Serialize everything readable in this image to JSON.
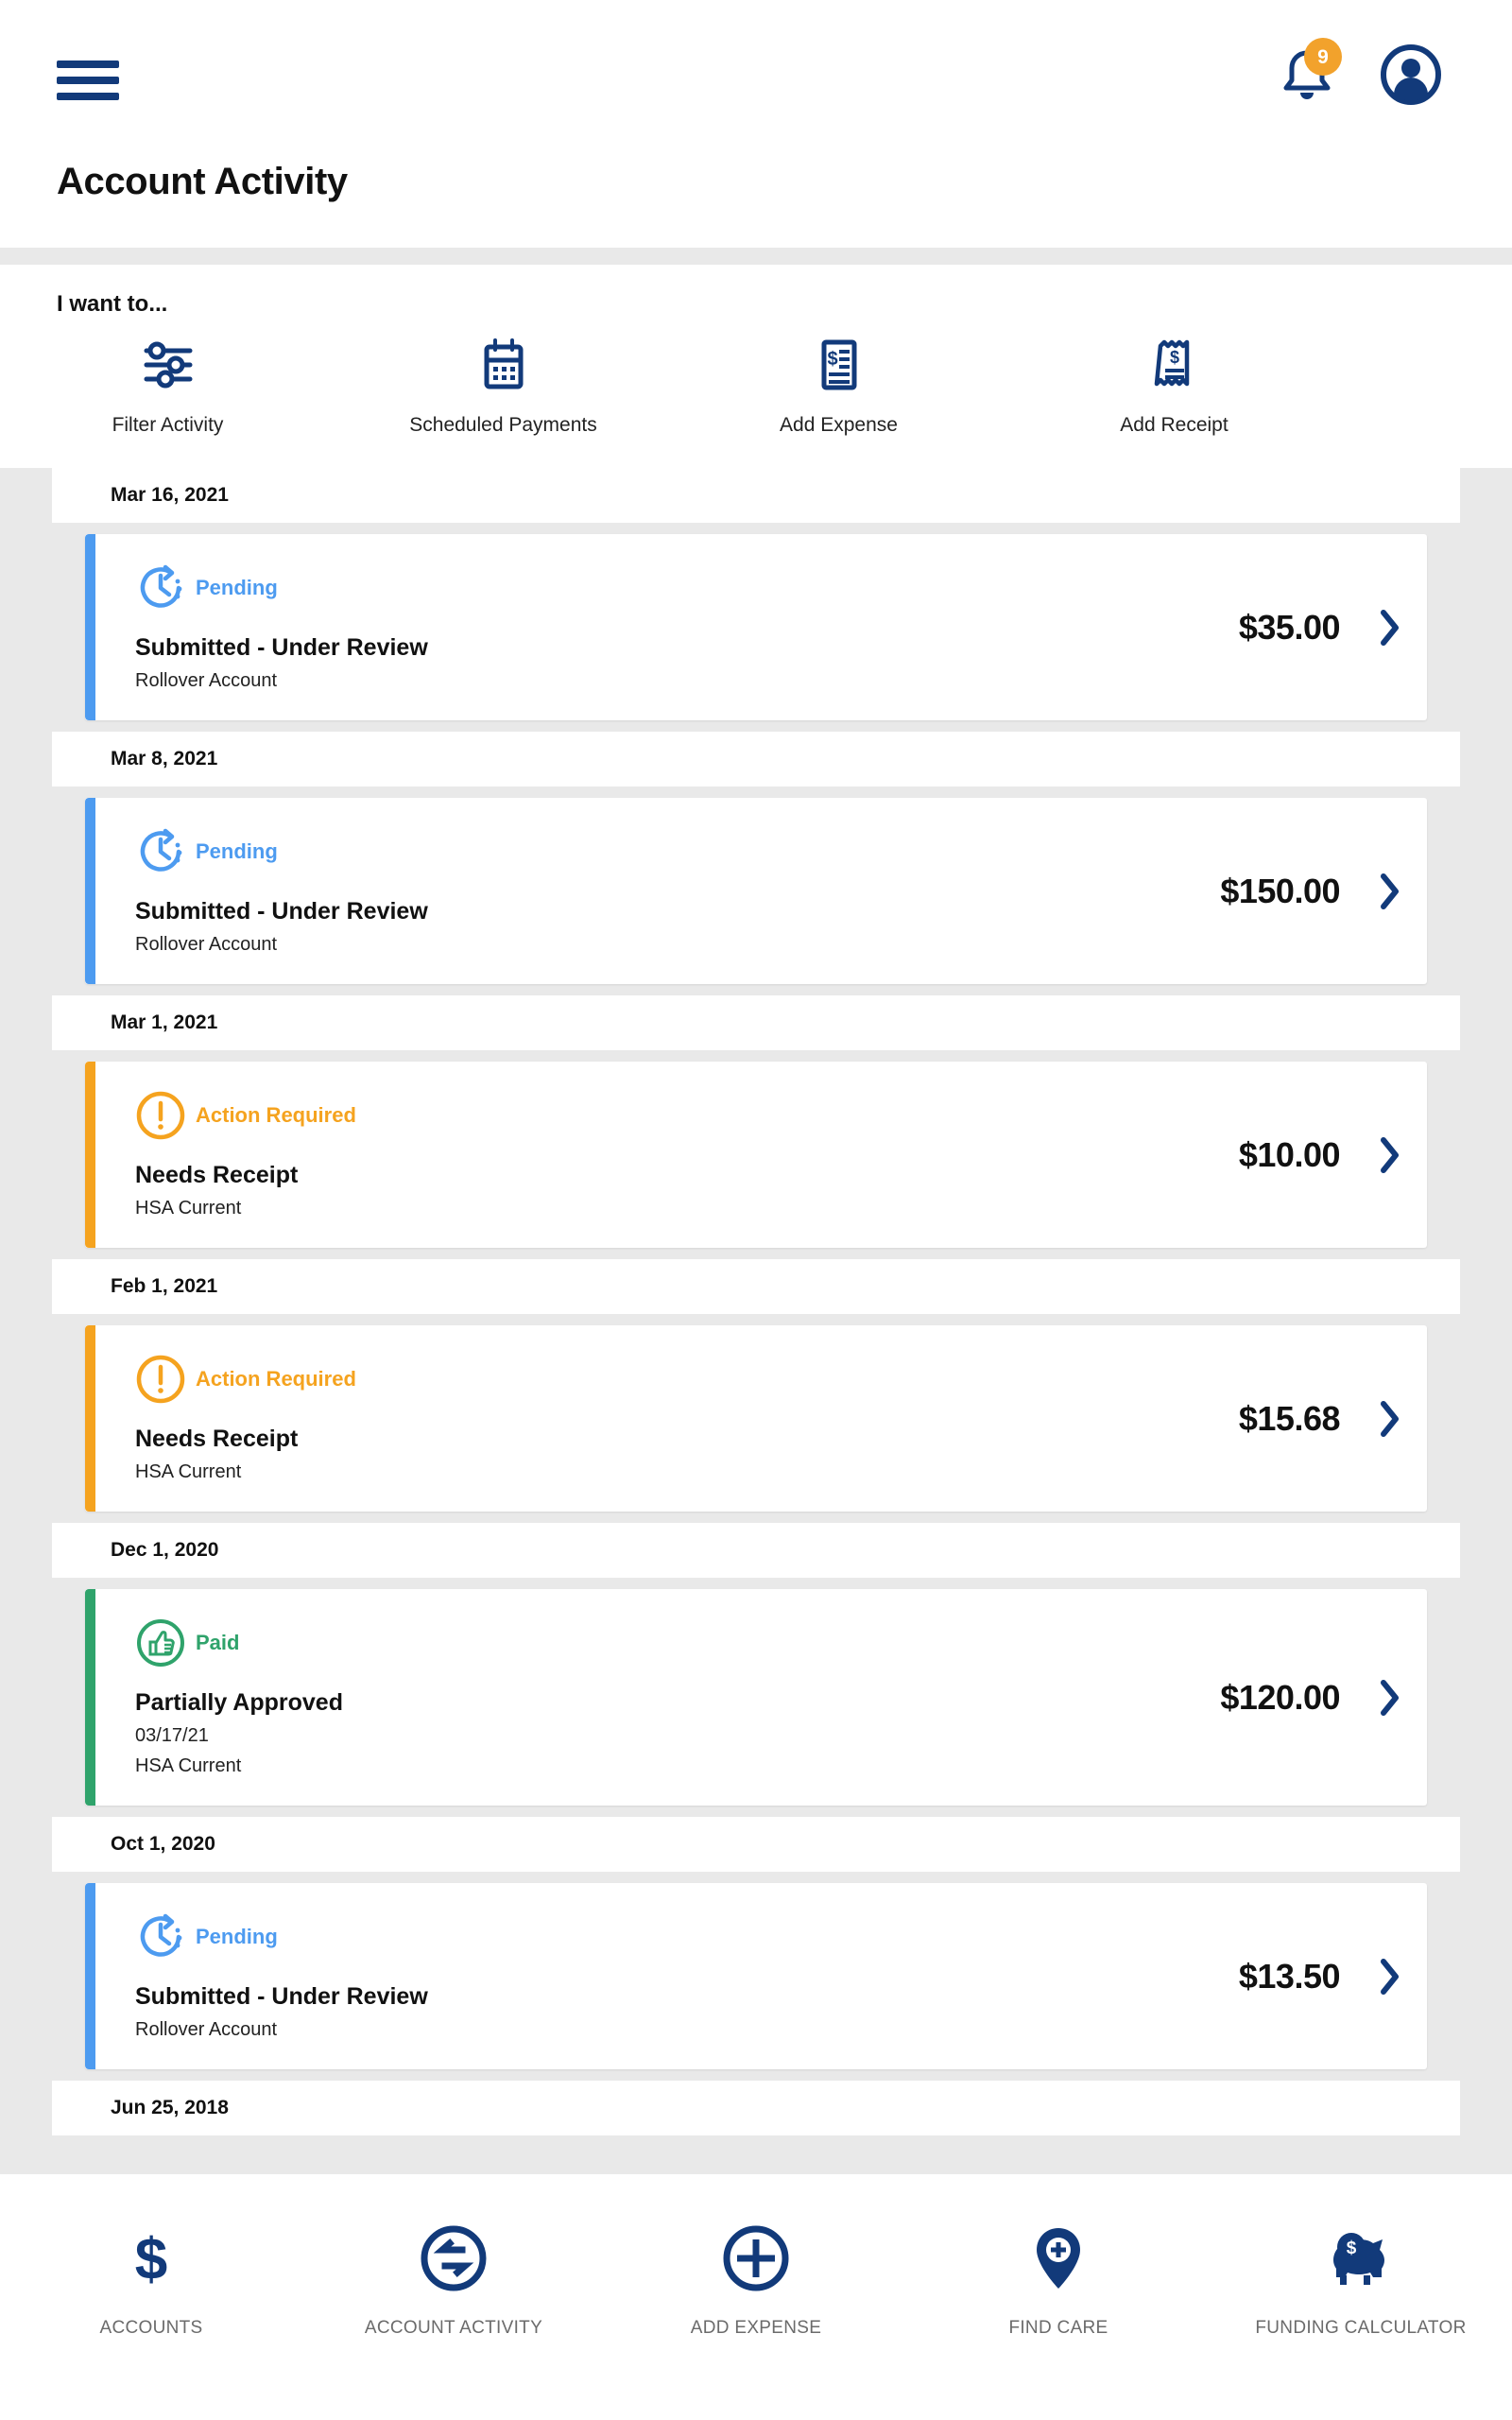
{
  "colors": {
    "brand_navy": "#123a7a",
    "accent_orange": "#f2a22c",
    "pending_blue": "#4d9bf0",
    "action_orange": "#f5a31f",
    "paid_green": "#2fa36b",
    "page_bg": "#e9e9e9",
    "chevron": "#123a7a"
  },
  "header": {
    "menu_icon": "hamburger-menu-icon",
    "notification_icon": "bell-icon",
    "notification_count": "9",
    "profile_icon": "user-avatar-icon",
    "title": "Account Activity"
  },
  "quick_actions": {
    "label": "I want to...",
    "items": [
      {
        "label": "Filter Activity",
        "icon": "sliders-filter-icon"
      },
      {
        "label": "Scheduled Payments",
        "icon": "calendar-icon"
      },
      {
        "label": "Add Expense",
        "icon": "document-dollar-icon"
      },
      {
        "label": "Add Receipt",
        "icon": "receipt-dollar-icon"
      }
    ]
  },
  "activity": {
    "groups": [
      {
        "date": "Mar 16, 2021",
        "item": {
          "status": "Pending",
          "status_type": "pending",
          "icon": "clock-pending-icon",
          "title": "Submitted - Under Review",
          "sub": "Rollover Account",
          "sub2": "",
          "amount": "$35.00",
          "chevron": "chevron-right-icon"
        }
      },
      {
        "date": "Mar 8, 2021",
        "item": {
          "status": "Pending",
          "status_type": "pending",
          "icon": "clock-pending-icon",
          "title": "Submitted - Under Review",
          "sub": "Rollover Account",
          "sub2": "",
          "amount": "$150.00",
          "chevron": "chevron-right-icon"
        }
      },
      {
        "date": "Mar 1, 2021",
        "item": {
          "status": "Action Required",
          "status_type": "action",
          "icon": "exclamation-circle-icon",
          "title": "Needs Receipt",
          "sub": "HSA Current",
          "sub2": "",
          "amount": "$10.00",
          "chevron": "chevron-right-icon"
        }
      },
      {
        "date": "Feb 1, 2021",
        "item": {
          "status": "Action Required",
          "status_type": "action",
          "icon": "exclamation-circle-icon",
          "title": "Needs Receipt",
          "sub": "HSA Current",
          "sub2": "",
          "amount": "$15.68",
          "chevron": "chevron-right-icon"
        }
      },
      {
        "date": "Dec 1, 2020",
        "item": {
          "status": "Paid",
          "status_type": "paid",
          "icon": "thumbs-up-circle-icon",
          "title": "Partially Approved",
          "sub": "03/17/21",
          "sub2": "HSA Current",
          "amount": "$120.00",
          "chevron": "chevron-right-icon"
        }
      },
      {
        "date": "Oct 1, 2020",
        "item": {
          "status": "Pending",
          "status_type": "pending",
          "icon": "clock-pending-icon",
          "title": "Submitted - Under Review",
          "sub": "Rollover Account",
          "sub2": "",
          "amount": "$13.50",
          "chevron": "chevron-right-icon"
        }
      },
      {
        "date": "Jun 25, 2018",
        "item": null
      }
    ]
  },
  "bottom_nav": {
    "items": [
      {
        "label": "ACCOUNTS",
        "icon": "dollar-sign-icon"
      },
      {
        "label": "ACCOUNT ACTIVITY",
        "icon": "transfer-arrows-circle-icon"
      },
      {
        "label": "ADD EXPENSE",
        "icon": "plus-circle-icon"
      },
      {
        "label": "FIND CARE",
        "icon": "map-pin-plus-icon"
      },
      {
        "label": "FUNDING CALCULATOR",
        "icon": "piggy-bank-icon"
      }
    ]
  }
}
